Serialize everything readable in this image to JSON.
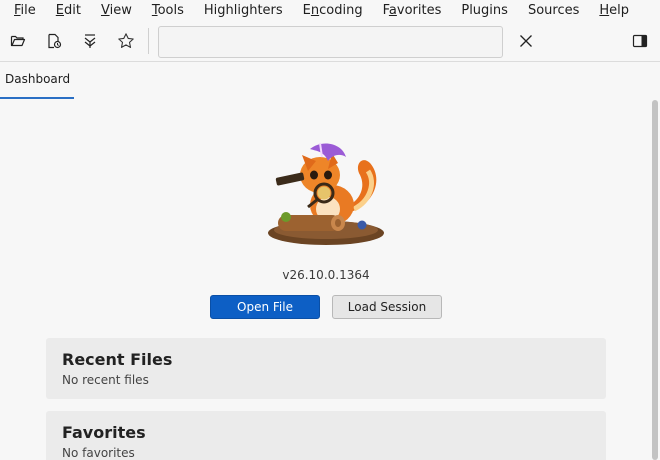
{
  "menubar": {
    "items": [
      {
        "label": "File",
        "underline": "F"
      },
      {
        "label": "Edit",
        "underline": "E"
      },
      {
        "label": "View",
        "underline": "V"
      },
      {
        "label": "Tools",
        "underline": "T"
      },
      {
        "label": "Highlighters",
        "underline": ""
      },
      {
        "label": "Encoding",
        "underline": "n"
      },
      {
        "label": "Favorites",
        "underline": "a"
      },
      {
        "label": "Plugins",
        "underline": ""
      },
      {
        "label": "Sources",
        "underline": ""
      },
      {
        "label": "Help",
        "underline": "H"
      }
    ]
  },
  "toolbar": {
    "search_value": "",
    "icons": [
      "folder-open-icon",
      "recent-file-icon",
      "filter-icon",
      "star-icon",
      "close-icon",
      "side-panel-icon"
    ]
  },
  "tabs": [
    {
      "label": "Dashboard",
      "active": true
    }
  ],
  "dashboard": {
    "version": "v26.10.0.1364",
    "open_file_label": "Open File",
    "load_session_label": "Load Session",
    "recent_title": "Recent Files",
    "recent_empty": "No recent files",
    "favorites_title": "Favorites",
    "favorites_empty": "No favorites"
  },
  "colors": {
    "accent": "#0d5fc5",
    "tab_underline": "#2a6fc4"
  }
}
